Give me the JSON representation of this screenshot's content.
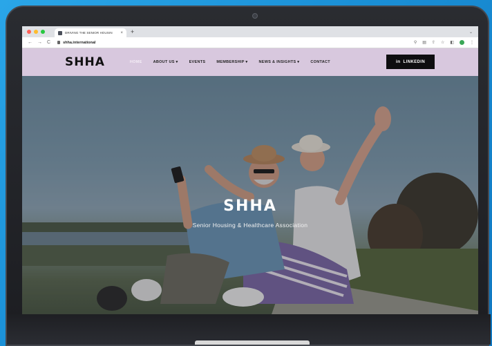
{
  "browser": {
    "tab_title": "DRIVING THE SENIOR HOUSIN",
    "tab_close": "×",
    "new_tab": "+",
    "url": "shha.international",
    "nav": {
      "back": "←",
      "forward": "→",
      "reload": "C"
    }
  },
  "site": {
    "logo": "SHHA",
    "menu": [
      {
        "label": "HOME",
        "active": true
      },
      {
        "label": "ABOUT US ▾"
      },
      {
        "label": "EVENTS"
      },
      {
        "label": "MEMBERSHIP ▾"
      },
      {
        "label": "NEWS & INSIGHTS ▾"
      },
      {
        "label": "CONTACT"
      }
    ],
    "linkedin_icon": "in",
    "linkedin_label": "LINKEDIN",
    "hero": {
      "title": "SHHA",
      "subtitle": "Senior Housing & Healthcare Association"
    }
  },
  "colors": {
    "nav_bg": "#d8c8de",
    "linkedin_bg": "#0e0e10",
    "page_bg": "#1a8fd6"
  }
}
